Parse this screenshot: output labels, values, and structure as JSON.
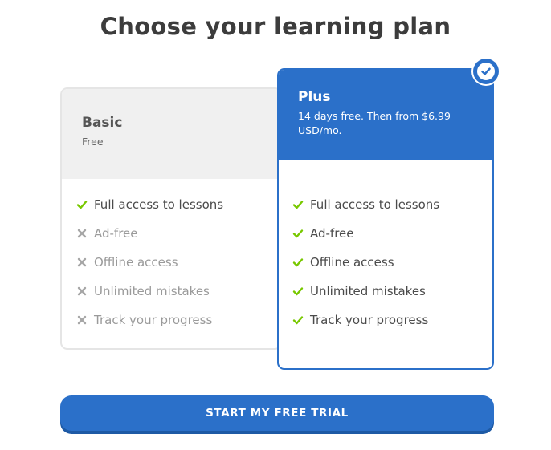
{
  "page": {
    "title": "Choose your learning plan"
  },
  "colors": {
    "accent": "#2b70c9",
    "check": "#78c800",
    "cross": "#a6a6a6"
  },
  "plans": {
    "basic": {
      "name": "Basic",
      "price": "Free",
      "features": [
        {
          "label": "Full access to lessons",
          "included": true,
          "icon": "check-icon"
        },
        {
          "label": "Ad-free",
          "included": false,
          "icon": "cross-icon"
        },
        {
          "label": "Offline access",
          "included": false,
          "icon": "cross-icon"
        },
        {
          "label": "Unlimited mistakes",
          "included": false,
          "icon": "cross-icon"
        },
        {
          "label": "Track your progress",
          "included": false,
          "icon": "cross-icon"
        }
      ]
    },
    "plus": {
      "name": "Plus",
      "price": "14 days free. Then from $6.99 USD/mo.",
      "selected": true,
      "badge_icon": "checkmark-circle-icon",
      "features": [
        {
          "label": "Full access to lessons",
          "included": true,
          "icon": "check-icon"
        },
        {
          "label": "Ad-free",
          "included": true,
          "icon": "check-icon"
        },
        {
          "label": "Offline access",
          "included": true,
          "icon": "check-icon"
        },
        {
          "label": "Unlimited mistakes",
          "included": true,
          "icon": "check-icon"
        },
        {
          "label": "Track your progress",
          "included": true,
          "icon": "check-icon"
        }
      ]
    }
  },
  "cta": {
    "label": "START MY FREE TRIAL"
  }
}
